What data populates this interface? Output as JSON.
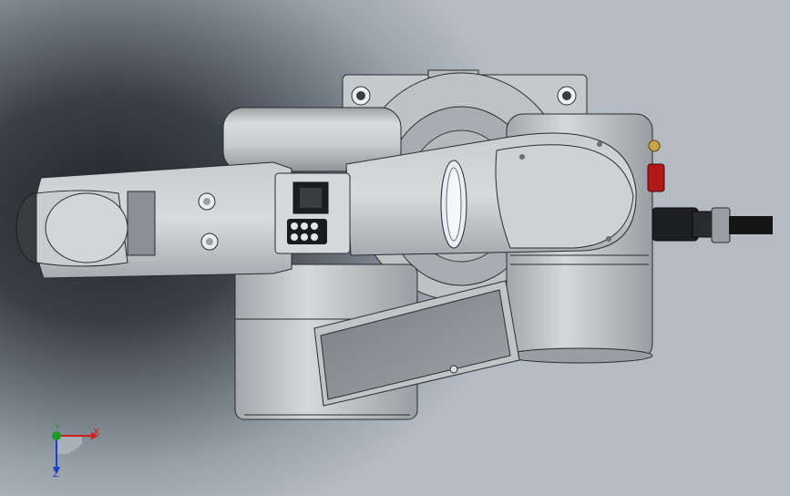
{
  "triad": {
    "x_label": "X",
    "y_label": "Y",
    "z_label": "Z"
  },
  "colors": {
    "part_light": "#d7d9db",
    "part_mid": "#b7babd",
    "part_dark": "#8d9195",
    "edge": "#2a2c2e",
    "connector_red": "#b01818",
    "cable": "#151515",
    "axis_x": "#d21e1e",
    "axis_y": "#1a9a2a",
    "axis_z": "#1f3fc8"
  }
}
